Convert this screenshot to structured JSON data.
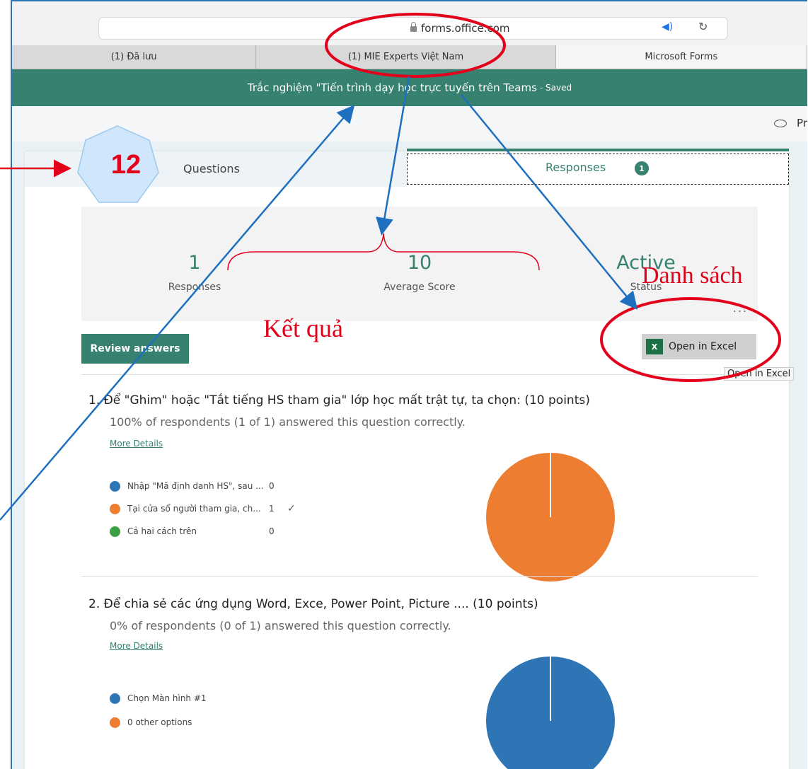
{
  "browser": {
    "url": "forms.office.com",
    "tabs": [
      "(1) Đã lưu",
      "(1) MIE Experts Việt Nam",
      "Microsoft Forms"
    ]
  },
  "header": {
    "title": "Trắc nghiệm \"Tiến trình dạy học trực tuyến trên Teams",
    "saved": "- Saved"
  },
  "toolbar": {
    "preview_label": "Pr"
  },
  "tabs": {
    "questions": "Questions",
    "responses": "Responses",
    "responses_badge": "1"
  },
  "summary": {
    "responses_value": "1",
    "responses_label": "Responses",
    "avg_value": "10",
    "avg_label": "Average Score",
    "status_value": "Active",
    "status_label": "Status",
    "more": "..."
  },
  "actions": {
    "review": "Review answers",
    "excel": "Open in Excel",
    "excel_tooltip": "Open in Excel"
  },
  "questions": [
    {
      "title": "1. Để \"Ghim\" hoặc \"Tắt tiếng HS tham gia\" lớp học mất trật tự, ta chọn: (10 points)",
      "stat": "100% of respondents (1 of 1) answered this question correctly.",
      "more": "More Details",
      "options": [
        {
          "label": "Nhập \"Mã định danh HS\", sau ...",
          "count": "0",
          "color": "#2e75b6",
          "correct": ""
        },
        {
          "label": "Tại cửa sổ người tham gia, ch...",
          "count": "1",
          "color": "#ed7d31",
          "correct": "✓"
        },
        {
          "label": "Cả hai cách trên",
          "count": "0",
          "color": "#3aa043",
          "correct": ""
        }
      ]
    },
    {
      "title": "2. Để chia sẻ các ứng dụng Word, Exce, Power Point, Picture .... (10 points)",
      "stat": "0% of respondents (0 of 1) answered this question correctly.",
      "more": "More Details",
      "options": [
        {
          "label": "Chọn Màn hình #1",
          "count": "",
          "color": "#2e75b6",
          "correct": ""
        },
        {
          "label": "0 other options",
          "count": "",
          "color": "#ed7d31",
          "correct": ""
        }
      ]
    }
  ],
  "annotations": {
    "number": "12",
    "ket_qua": "Kết quả",
    "danh_sach": "Danh sách"
  },
  "colors": {
    "brand": "#368170",
    "annot_red": "#e3001b",
    "annot_blue": "#1f6fc0"
  }
}
